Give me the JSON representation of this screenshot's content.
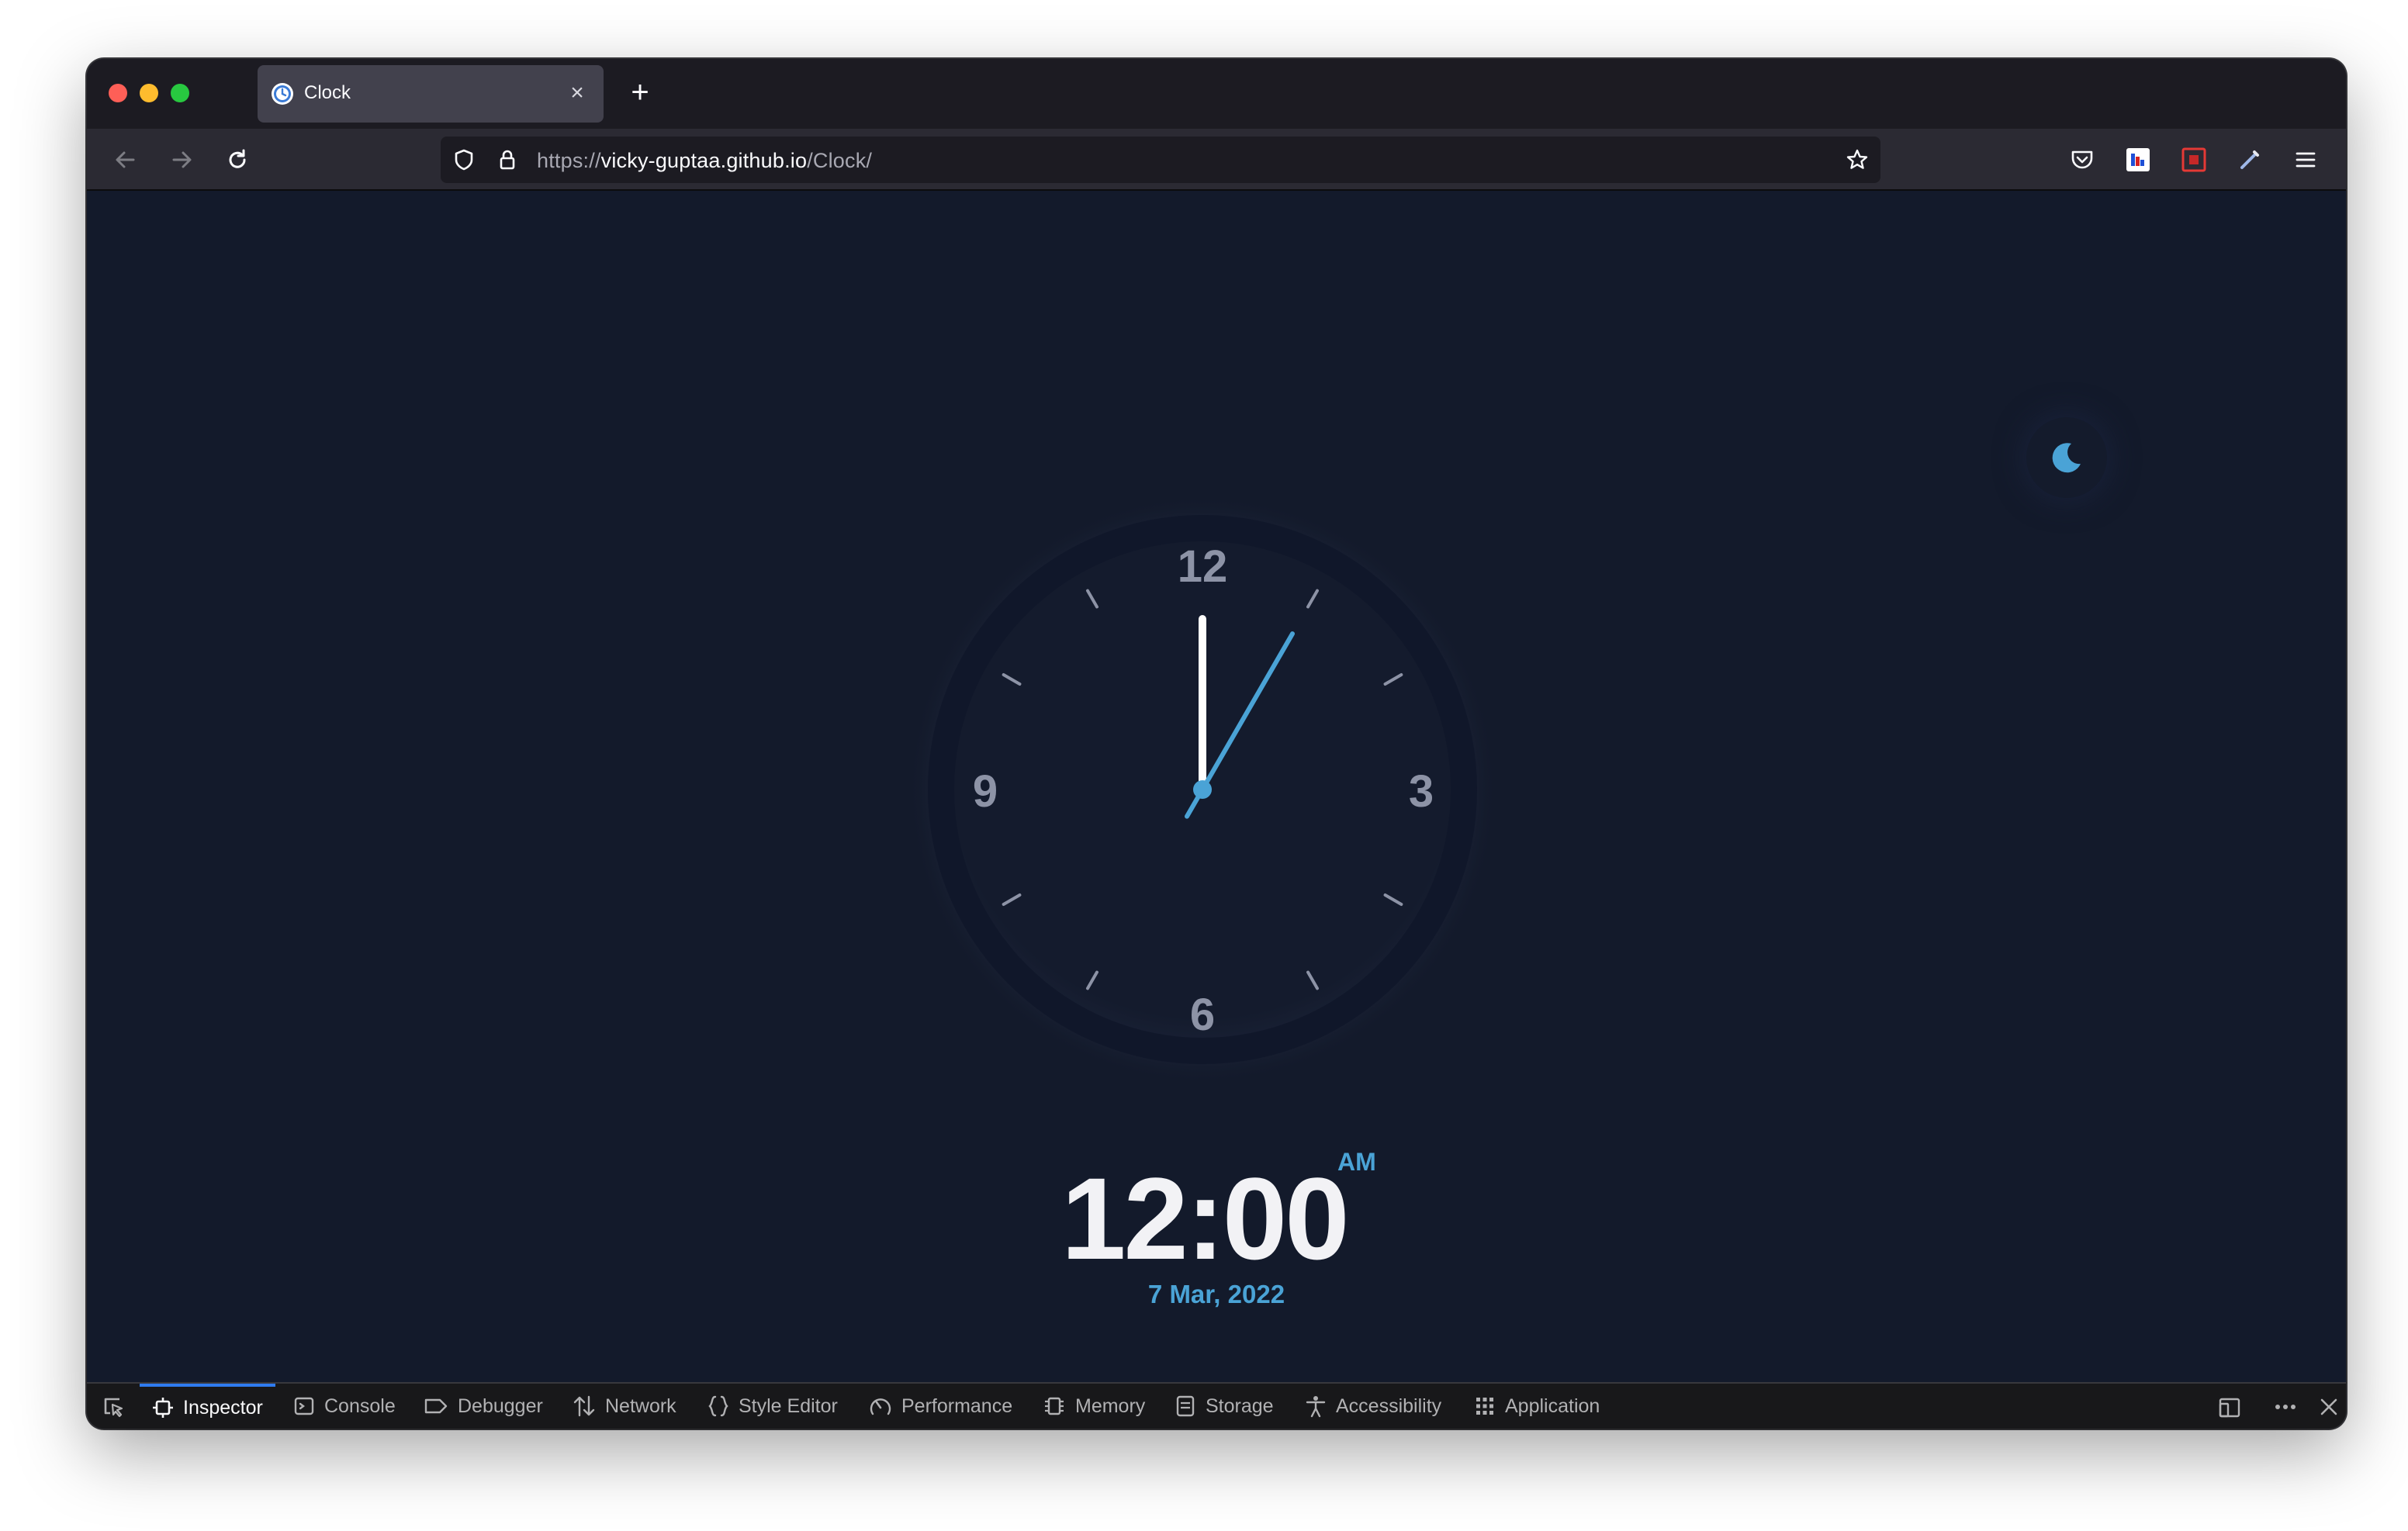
{
  "browser": {
    "tab": {
      "title": "Clock",
      "close_glyph": "×",
      "favicon": "clock-icon"
    },
    "new_tab_glyph": "+",
    "url": {
      "scheme": "https://",
      "host": "vicky-guptaa.github.io",
      "path": "/Clock/"
    }
  },
  "page": {
    "theme_toggle_icon": "moon-icon",
    "clock": {
      "numerals": [
        "12",
        "3",
        "6",
        "9"
      ],
      "accent_color": "#4aa3d6",
      "hour_hand_color": "#ffffff",
      "hour": 12,
      "minute": 0,
      "second": 5
    },
    "digital_time": "12:00",
    "ampm": "AM",
    "date": "7 Mar, 2022"
  },
  "devtools": {
    "tabs": [
      {
        "label": "Inspector",
        "icon": "inspector-icon",
        "active": true
      },
      {
        "label": "Console",
        "icon": "console-icon"
      },
      {
        "label": "Debugger",
        "icon": "debugger-icon"
      },
      {
        "label": "Network",
        "icon": "network-icon"
      },
      {
        "label": "Style Editor",
        "icon": "style-editor-icon"
      },
      {
        "label": "Performance",
        "icon": "performance-icon"
      },
      {
        "label": "Memory",
        "icon": "memory-icon"
      },
      {
        "label": "Storage",
        "icon": "storage-icon"
      },
      {
        "label": "Accessibility",
        "icon": "accessibility-icon"
      },
      {
        "label": "Application",
        "icon": "application-icon"
      }
    ]
  }
}
